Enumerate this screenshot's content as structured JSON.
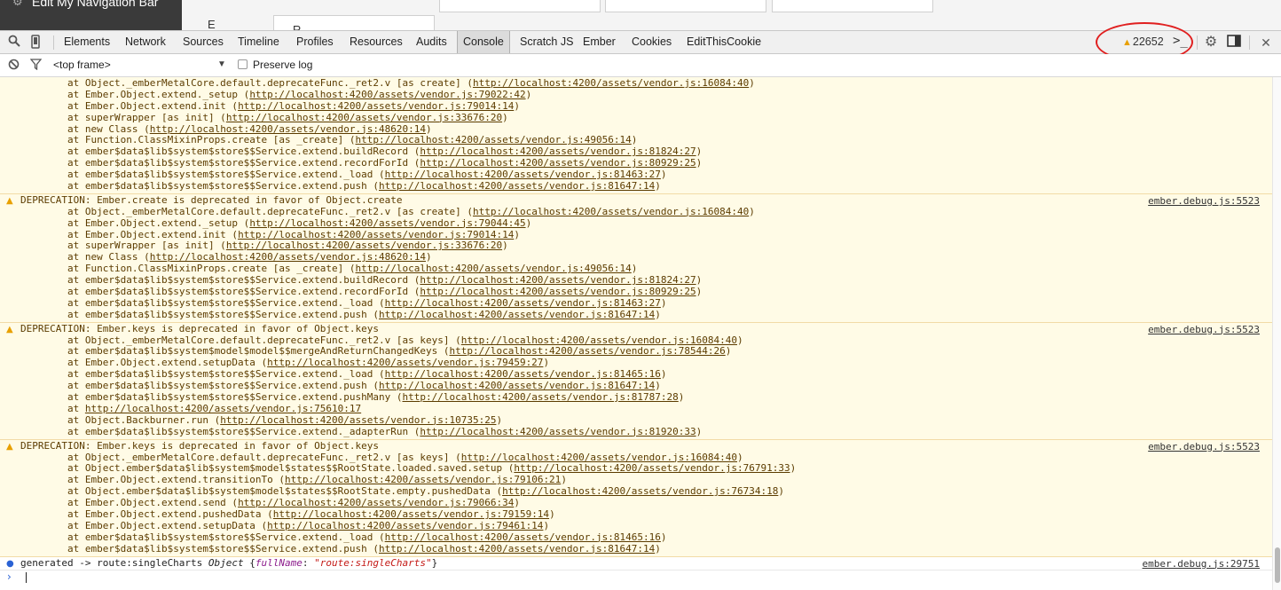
{
  "page": {
    "nav_title": "Edit My Navigation Bar",
    "label_e": "E",
    "box_text": "R"
  },
  "toolbar": {
    "tabs": [
      "Elements",
      "Network",
      "Sources",
      "Timeline",
      "Profiles",
      "Resources",
      "Audits",
      "Console",
      "Scratch JS",
      "Ember",
      "Cookies",
      "EditThisCookie"
    ],
    "active_tab": "Console",
    "warning_count": "22652"
  },
  "filter": {
    "frame": "<top frame>",
    "preserve_log": "Preserve log"
  },
  "console": {
    "partial_message": {
      "frames": [
        "at Object._emberMetalCore.default.deprecateFunc._ret2.v [as create] (|http://localhost:4200/assets/vendor.js:16084:40|)",
        "at Ember.Object.extend._setup (|http://localhost:4200/assets/vendor.js:79022:42|)",
        "at Ember.Object.extend.init (|http://localhost:4200/assets/vendor.js:79014:14|)",
        "at superWrapper [as init] (|http://localhost:4200/assets/vendor.js:33676:20|)",
        "at new Class (|http://localhost:4200/assets/vendor.js:48620:14|)",
        "at Function.ClassMixinProps.create [as _create] (|http://localhost:4200/assets/vendor.js:49056:14|)",
        "at ember$data$lib$system$store$$Service.extend.buildRecord (|http://localhost:4200/assets/vendor.js:81824:27|)",
        "at ember$data$lib$system$store$$Service.extend.recordForId (|http://localhost:4200/assets/vendor.js:80929:25|)",
        "at ember$data$lib$system$store$$Service.extend._load (|http://localhost:4200/assets/vendor.js:81463:27|)",
        "at ember$data$lib$system$store$$Service.extend.push (|http://localhost:4200/assets/vendor.js:81647:14|)"
      ]
    },
    "messages": [
      {
        "text": "DEPRECATION: Ember.create is deprecated in favor of Object.create",
        "source": "ember.debug.js:5523",
        "frames": [
          "at Object._emberMetalCore.default.deprecateFunc._ret2.v [as create] (|http://localhost:4200/assets/vendor.js:16084:40|)",
          "at Ember.Object.extend._setup (|http://localhost:4200/assets/vendor.js:79044:45|)",
          "at Ember.Object.extend.init (|http://localhost:4200/assets/vendor.js:79014:14|)",
          "at superWrapper [as init] (|http://localhost:4200/assets/vendor.js:33676:20|)",
          "at new Class (|http://localhost:4200/assets/vendor.js:48620:14|)",
          "at Function.ClassMixinProps.create [as _create] (|http://localhost:4200/assets/vendor.js:49056:14|)",
          "at ember$data$lib$system$store$$Service.extend.buildRecord (|http://localhost:4200/assets/vendor.js:81824:27|)",
          "at ember$data$lib$system$store$$Service.extend.recordForId (|http://localhost:4200/assets/vendor.js:80929:25|)",
          "at ember$data$lib$system$store$$Service.extend._load (|http://localhost:4200/assets/vendor.js:81463:27|)",
          "at ember$data$lib$system$store$$Service.extend.push (|http://localhost:4200/assets/vendor.js:81647:14|)"
        ]
      },
      {
        "text": "DEPRECATION: Ember.keys is deprecated in favor of Object.keys",
        "source": "ember.debug.js:5523",
        "frames": [
          "at Object._emberMetalCore.default.deprecateFunc._ret2.v [as keys] (|http://localhost:4200/assets/vendor.js:16084:40|)",
          "at ember$data$lib$system$model$model$$mergeAndReturnChangedKeys (|http://localhost:4200/assets/vendor.js:78544:26|)",
          "at Ember.Object.extend.setupData (|http://localhost:4200/assets/vendor.js:79459:27|)",
          "at ember$data$lib$system$store$$Service.extend._load (|http://localhost:4200/assets/vendor.js:81465:16|)",
          "at ember$data$lib$system$store$$Service.extend.push (|http://localhost:4200/assets/vendor.js:81647:14|)",
          "at ember$data$lib$system$store$$Service.extend.pushMany (|http://localhost:4200/assets/vendor.js:81787:28|)",
          "at |http://localhost:4200/assets/vendor.js:75610:17|",
          "at Object.Backburner.run (|http://localhost:4200/assets/vendor.js:10735:25|)",
          "at ember$data$lib$system$store$$Service.extend._adapterRun (|http://localhost:4200/assets/vendor.js:81920:33|)"
        ]
      },
      {
        "text": "DEPRECATION: Ember.keys is deprecated in favor of Object.keys",
        "source": "ember.debug.js:5523",
        "frames": [
          "at Object._emberMetalCore.default.deprecateFunc._ret2.v [as keys] (|http://localhost:4200/assets/vendor.js:16084:40|)",
          "at Object.ember$data$lib$system$model$states$$RootState.loaded.saved.setup (|http://localhost:4200/assets/vendor.js:76791:33|)",
          "at Ember.Object.extend.transitionTo (|http://localhost:4200/assets/vendor.js:79106:21|)",
          "at Object.ember$data$lib$system$model$states$$RootState.empty.pushedData (|http://localhost:4200/assets/vendor.js:76734:18|)",
          "at Ember.Object.extend.send (|http://localhost:4200/assets/vendor.js:79066:34|)",
          "at Ember.Object.extend.pushedData (|http://localhost:4200/assets/vendor.js:79159:14|)",
          "at Ember.Object.extend.setupData (|http://localhost:4200/assets/vendor.js:79461:14|)",
          "at ember$data$lib$system$store$$Service.extend._load (|http://localhost:4200/assets/vendor.js:81465:16|)",
          "at ember$data$lib$system$store$$Service.extend.push (|http://localhost:4200/assets/vendor.js:81647:14|)"
        ]
      }
    ],
    "info": {
      "prefix": "generated -> route:singleCharts ",
      "obj": "Object ",
      "brace_open": "{",
      "key": "fullName",
      "colon": ": ",
      "value": "\"route:singleCharts\"",
      "brace_close": "}",
      "source": "ember.debug.js:29751"
    }
  },
  "colors": {
    "warning_bg": "#fffbe6",
    "warning_text": "#5c3c00",
    "warning_icon": "#e8a000",
    "annotation": "#e02020",
    "info_icon": "#2a62d4"
  }
}
